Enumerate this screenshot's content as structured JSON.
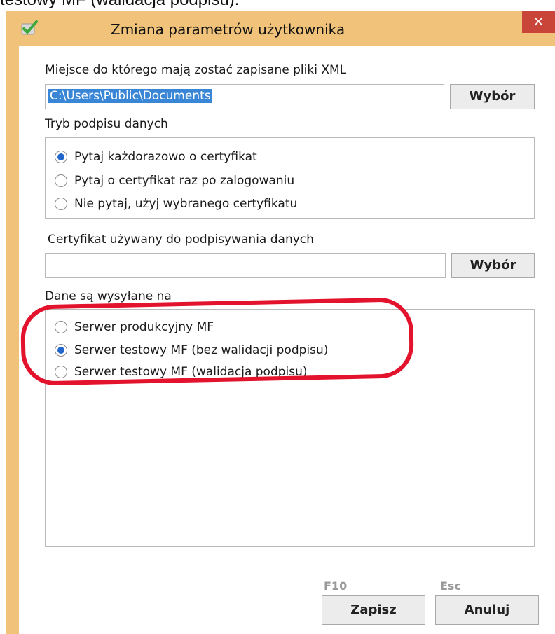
{
  "caption": {
    "text": "testowy MF (walidacja podpisu)."
  },
  "window": {
    "title": "Zmiana parametrów użytkownika",
    "close_glyph": "×",
    "app_icon": "checkmark-pencil-icon"
  },
  "xml_path": {
    "label": "Miejsce do którego mają zostać zapisane pliki XML",
    "value": "C:\\Users\\Public\\Documents",
    "browse_label": "Wybór"
  },
  "sign_mode": {
    "label": "Tryb podpisu danych",
    "options": [
      {
        "label": "Pytaj każdorazowo o certyfikat",
        "checked": true
      },
      {
        "label": "Pytaj o certyfikat raz po zalogowaniu",
        "checked": false
      },
      {
        "label": "Nie pytaj, użyj wybranego certyfikatu",
        "checked": false
      }
    ]
  },
  "certificate": {
    "label": "Certyfikat używany do podpisywania danych",
    "value": "",
    "browse_label": "Wybór"
  },
  "server": {
    "label": "Dane są wysyłane na",
    "options": [
      {
        "label": "Serwer produkcyjny MF",
        "checked": false
      },
      {
        "label": "Serwer testowy MF (bez walidacji podpisu)",
        "checked": true
      },
      {
        "label": "Serwer testowy MF (walidacja podpisu)",
        "checked": false
      }
    ]
  },
  "footer": {
    "save_hotkey": "F10",
    "cancel_hotkey": "Esc",
    "save_label": "Zapisz",
    "cancel_label": "Anuluj"
  },
  "colors": {
    "window_frame": "#f0c27a",
    "close_button": "#c9453a",
    "selection": "#3a86d6",
    "radio_dot": "#2266cc",
    "annotation": "#e3122d"
  }
}
